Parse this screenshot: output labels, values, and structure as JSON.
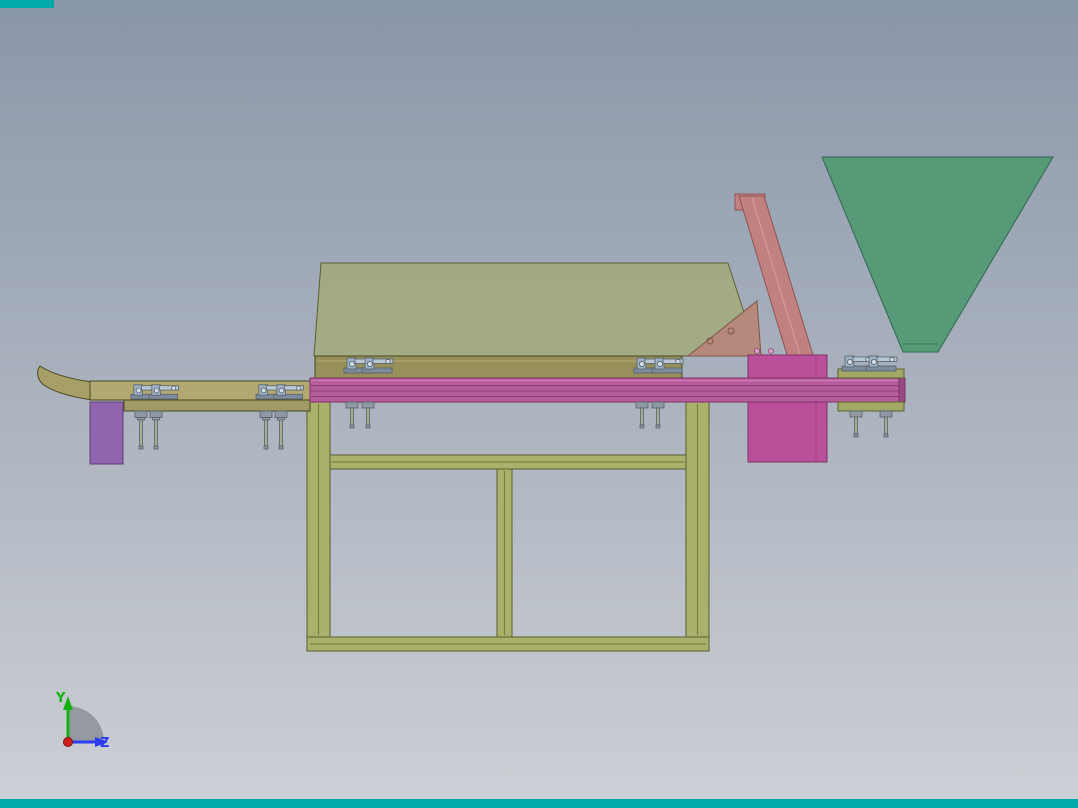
{
  "viewport": {
    "bg_top": "#8a96a9",
    "bg_bottom": "#cdd0d5",
    "chrome_color": "#00a9ac"
  },
  "triad": {
    "y_label": "Y",
    "z_label": "Z",
    "y_color": "#14b014",
    "z_color": "#2b3cf2",
    "x_dot_color": "#cf2020",
    "sector_color": "#596067"
  },
  "colors": {
    "frame": "#a9b16a",
    "frame_groove": "#78803f",
    "rail": "#b75c9d",
    "rail_stripe": "#8a4076",
    "rail_highlight": "#d37fb7",
    "rail_end": "#9a4a82",
    "strip": "#97905a",
    "strip_highlight": "#b3ab74",
    "panel": "#a2ab74",
    "hopper": "#579a78",
    "arm": "#c28181",
    "arm_highlight": "#d4a0a0",
    "gusset": "#b5897b",
    "box": "#bc4f9a",
    "purple_block": "#9165ae",
    "left_bar": "#b1a872",
    "left_bar_lower": "#a29a65",
    "chute": "#a89f68",
    "block_right": "#a3a866",
    "clamp_body": "#9db1c5",
    "clamp_base": "#7d8b9c",
    "clamp_arm": "#bac7d5",
    "clamp_pivot": "#d3dbe3",
    "screw_head": "#8f99a3",
    "screw_rod": "#a8ae8b",
    "bolt_dot": "#dca4c8"
  }
}
